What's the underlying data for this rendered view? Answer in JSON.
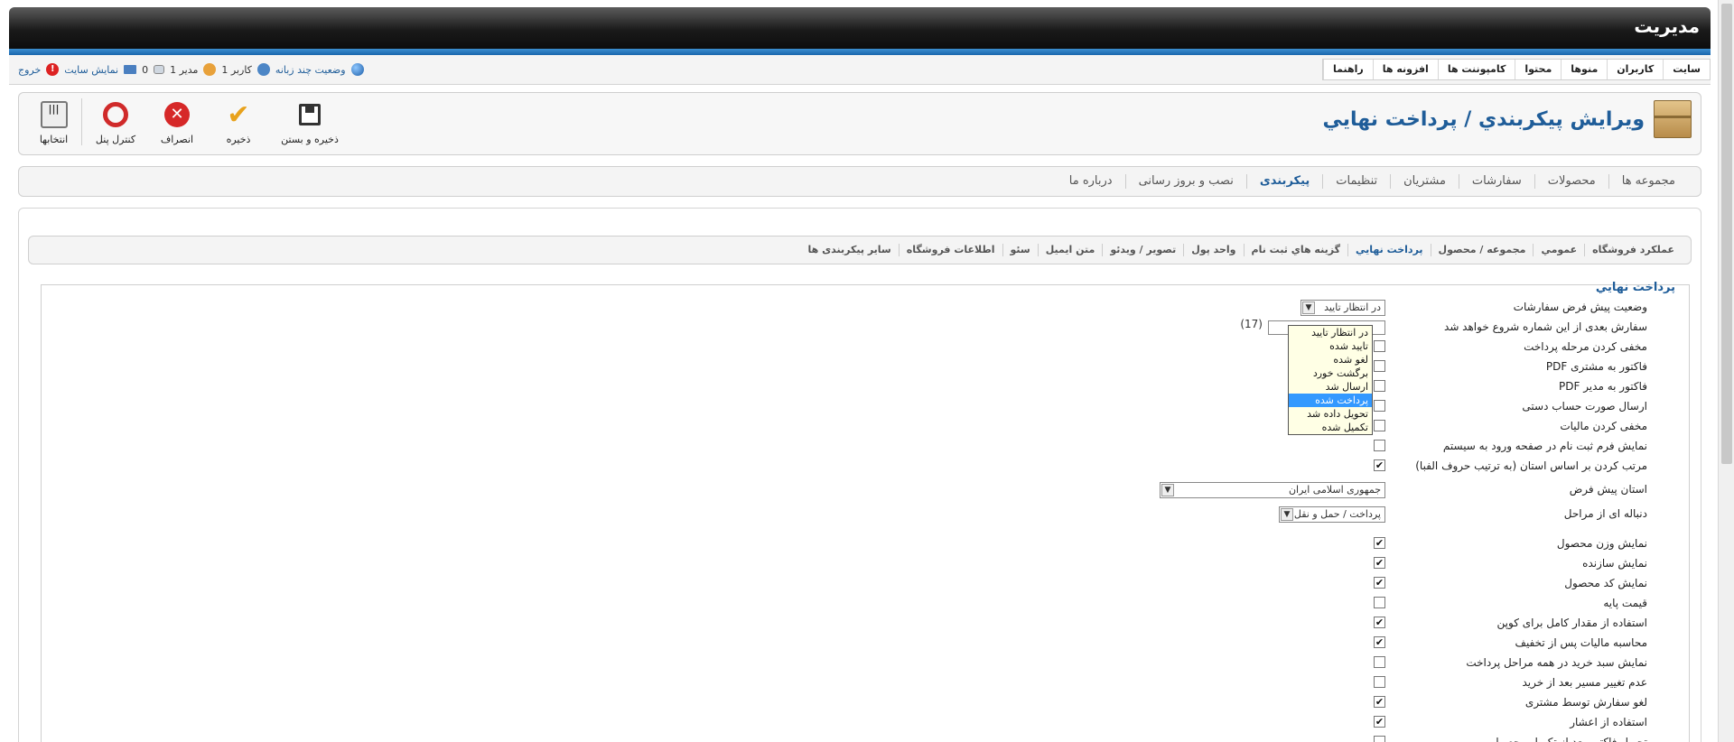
{
  "header": {
    "title": "مدیریت"
  },
  "menu": [
    "سایت",
    "کاربران",
    "منوها",
    "محتوا",
    "کامپوننت ها",
    "افزونه ها",
    "راهنما"
  ],
  "status": {
    "multilang": "وضعیت چند زبانه",
    "users_count": "1 کاربر",
    "admins_count": "1 مدیر",
    "messages_count": "0",
    "view_site": "نمایش سایت",
    "logout": "خروج"
  },
  "toolbar": {
    "page_title": "ويرايش پيکربندي / پرداخت نهايي",
    "buttons": [
      {
        "label": "ذخیره و بستن",
        "icon": "save-icon"
      },
      {
        "label": "ذخیره",
        "icon": "check-icon"
      },
      {
        "label": "انصراف",
        "icon": "cancel-icon"
      },
      {
        "label": "کنترل پنل",
        "icon": "control-panel-icon"
      },
      {
        "label": "انتخابها",
        "icon": "options-icon"
      }
    ]
  },
  "main_tabs": [
    "مجموعه ها",
    "محصولات",
    "سفارشات",
    "مشتریان",
    "تنظیمات",
    "پیکربندی",
    "نصب و بروز رسانی",
    "درباره ما"
  ],
  "main_tab_active": 5,
  "sub_tabs": [
    "عملكرد فروشگاه",
    "عمومي",
    "مجموعه / محصول",
    "پرداخت نهايي",
    "گزينه هاي ثبت نام",
    "واحد پول",
    "تصوير / ويدئو",
    "متن ايميل",
    "سئو",
    "اطلاعات فروشگاه",
    "ساير پيكربندی ها"
  ],
  "sub_tab_active": 3,
  "section_title": "پرداخت نهايي",
  "form": {
    "order_status_label": "وضعیت پیش فرض سفارشات",
    "order_status_value": "در انتظار تایید",
    "order_status_options": [
      "در انتظار تایید",
      "تایید شده",
      "لغو شده",
      "برگشت خورد",
      "ارسال شد",
      "پرداخت شده",
      "تحویل داده شد",
      "تکمیل شده"
    ],
    "order_status_highlight": 5,
    "next_order_label": "سفارش بعدی از این شماره شروع خواهد شد",
    "next_order_hint": "(17)",
    "hide_payment_step": "مخفی کردن مرحله پرداخت",
    "pdf_invoice_customer": "PDF فاکتور به مشتری",
    "pdf_invoice_admin": "PDF فاکتور به مدیر",
    "manual_invoice": "ارسال صورت حساب دستی",
    "hide_tax": "مخفی کردن مالیات",
    "show_register_form": "نمایش فرم ثبت نام در صفحه ورود به سیستم",
    "sort_by_state": "مرتب کردن بر اساس استان (به ترتیب حروف الفبا)",
    "default_state_label": "استان پیش فرض",
    "default_state_value": "جمهوری اسلامی ایران",
    "steps_sequence_label": "دنباله ای از مراحل",
    "steps_sequence_value": "پرداخت / حمل و نقل",
    "checkboxes": [
      {
        "label": "نمایش وزن محصول",
        "checked": true
      },
      {
        "label": "نمایش سازنده",
        "checked": true
      },
      {
        "label": "نمایش کد محصول",
        "checked": true
      },
      {
        "label": "قیمت پایه",
        "checked": false
      },
      {
        "label": "استفاده از مقدار کامل برای کوپن",
        "checked": true
      },
      {
        "label": "محاسبه مالیات پس از تخفیف",
        "checked": true
      },
      {
        "label": "نمایش سبد خرید در همه مراحل پرداخت",
        "checked": false
      },
      {
        "label": "عدم تغییر مسیر بعد از خرید",
        "checked": false
      },
      {
        "label": "لغو سفارش توسط مشتری",
        "checked": true
      },
      {
        "label": "استفاده از اعشار",
        "checked": true
      },
      {
        "label": "تحویل فاکتور بعد از تکمیل محصول",
        "checked": false
      }
    ],
    "upper_checks": {
      "sort_by_state": true,
      "hide_tax": false,
      "show_register_form": false
    }
  },
  "colors": {
    "accent": "#1f5d99",
    "header_dark": "#1a1a1a",
    "stripe": "#2a7cc2",
    "dropdown_bg": "#ffffe5",
    "selection": "#3399ff"
  }
}
